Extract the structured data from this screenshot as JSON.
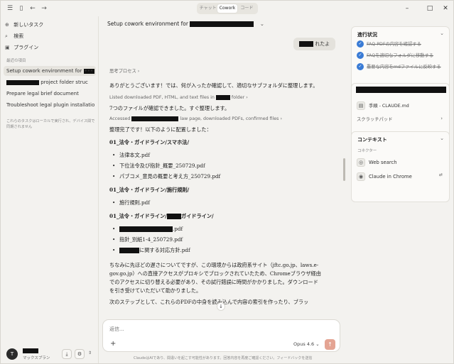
{
  "titlebar": {
    "modes": [
      "チャット",
      "Cowork",
      "コード"
    ],
    "active_mode": "Cowork"
  },
  "sidebar": {
    "new_task": "新しいタスク",
    "search": "検索",
    "plugins": "プラグイン",
    "recent_header": "最近の項目",
    "recent": [
      "Setup cowork environment for",
      "project folder struc",
      "Prepare legal brief document",
      "Troubleshoot legal plugin installatio"
    ],
    "note": "これらのタスクはローカルで実行され、デバイス間で同期されません",
    "user_initial": "T",
    "user_plan": "マックスプラン"
  },
  "main": {
    "title": "Setup cowork environment for",
    "user_message_suffix": "れたよ",
    "thinking_label": "思考プロセス",
    "p1": "ありがとうございます！では、何が入ったか確認して、適切なサブフォルダに整理します。",
    "tool1_prefix": "Listed downloaded PDF, HTML, and text files in",
    "tool1_suffix": "folder",
    "p2": "7つのファイルが確認できました。すぐ整理します。",
    "tool2_prefix": "Accessed",
    "tool2_suffix": "law page, downloaded PDFs, confirmed files",
    "p3": "整理完了です！以下のように配置しました：",
    "sec1": "01_法令・ガイドライン/スマホ法/",
    "sec1_items": [
      "法律本文.pdf",
      "下位法令及び指針_概要_250729.pdf",
      "パブコメ_意見の概要と考え方_250729.pdf"
    ],
    "sec2": "01_法令・ガイドライン/施行規則/",
    "sec2_items": [
      "施行規則.pdf"
    ],
    "sec3_prefix": "01_法令・ガイドライン/",
    "sec3_suffix": "ガイドライン/",
    "sec3_item1_suffix": ".pdf",
    "sec3_item2": "指針_別紙1-4_250729.pdf",
    "sec3_item3_suffix": "に関する対応方針.pdf",
    "p4": "ちなみに先ほどの遅さについてですが、この環境からは政府系サイト（jftc.go.jp、laws.e-gov.go.jp）への直接アクセスがプロキシでブロックされていたため、Chromeブラウザ経由でのアクセスに切り替える必要があり、その試行錯誤に時間がかかりました。ダウンロードを引き受けていただいて助かりました。",
    "p5": "次のステップとして、これらのPDFの中身を読み込んで内容の索引を作ったり、ブラッ",
    "composer_placeholder": "返信...",
    "model": "Opus 4.6",
    "disclaimer": "ClaudeはAIであり、間違いを起こす可能性があります。回答内容を再度ご確認ください。フィードバックを送信"
  },
  "right_panel": {
    "progress_title": "進行状況",
    "progress_items": [
      "FAQ PDFの内容を確認する",
      "FAQを適切なフォルダに移動する",
      "重要な内容をmdファイルに反映する"
    ],
    "file_name": "手順 - CLAUDE.md",
    "scratchpad": "スクラッチパッド",
    "context_title": "コンテキスト",
    "connectors_label": "コネクター",
    "connectors": [
      "Web search",
      "Claude in Chrome"
    ]
  }
}
